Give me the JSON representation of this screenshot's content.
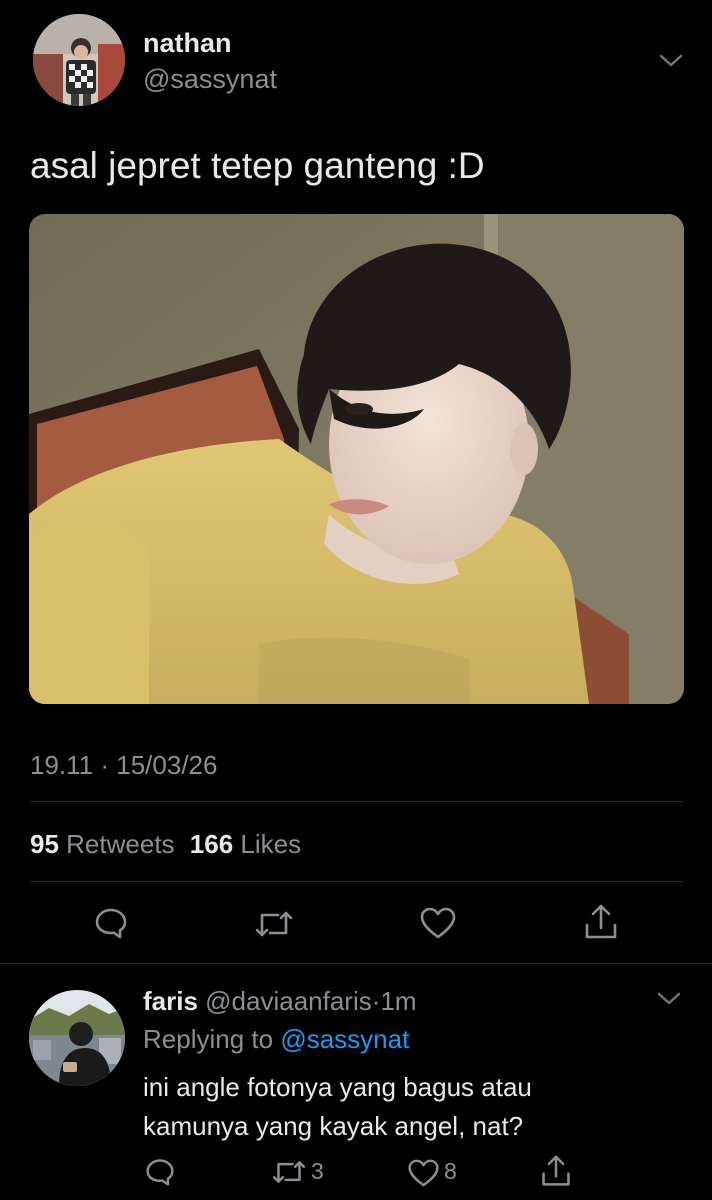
{
  "tweet": {
    "author": {
      "name": "nathan",
      "handle": "@sassynat"
    },
    "text": "asal jepret tetep ganteng :D",
    "time": "19.11",
    "date": "15/03/26",
    "retweets_count": "95",
    "retweets_label": "Retweets",
    "likes_count": "166",
    "likes_label": "Likes"
  },
  "reply": {
    "author": {
      "name": "faris",
      "handle": "@daviaanfaris",
      "age": "1m"
    },
    "replying_prefix": "Replying to",
    "replying_handle": "@sassynat",
    "text_line1": "ini angle fotonya yang bagus atau",
    "text_line2": "kamunya yang kayak angel, nat?",
    "retweets": "3",
    "likes": "8"
  },
  "icons": {
    "more": "chevron-down-icon",
    "reply": "speech-bubble-icon",
    "retweet": "retweet-icon",
    "like": "heart-icon",
    "share": "share-icon"
  },
  "colors": {
    "background": "#000000",
    "text": "#e7e9ea",
    "muted": "#8b8f94",
    "link": "#1d9bf0",
    "divider": "#2f3336"
  }
}
